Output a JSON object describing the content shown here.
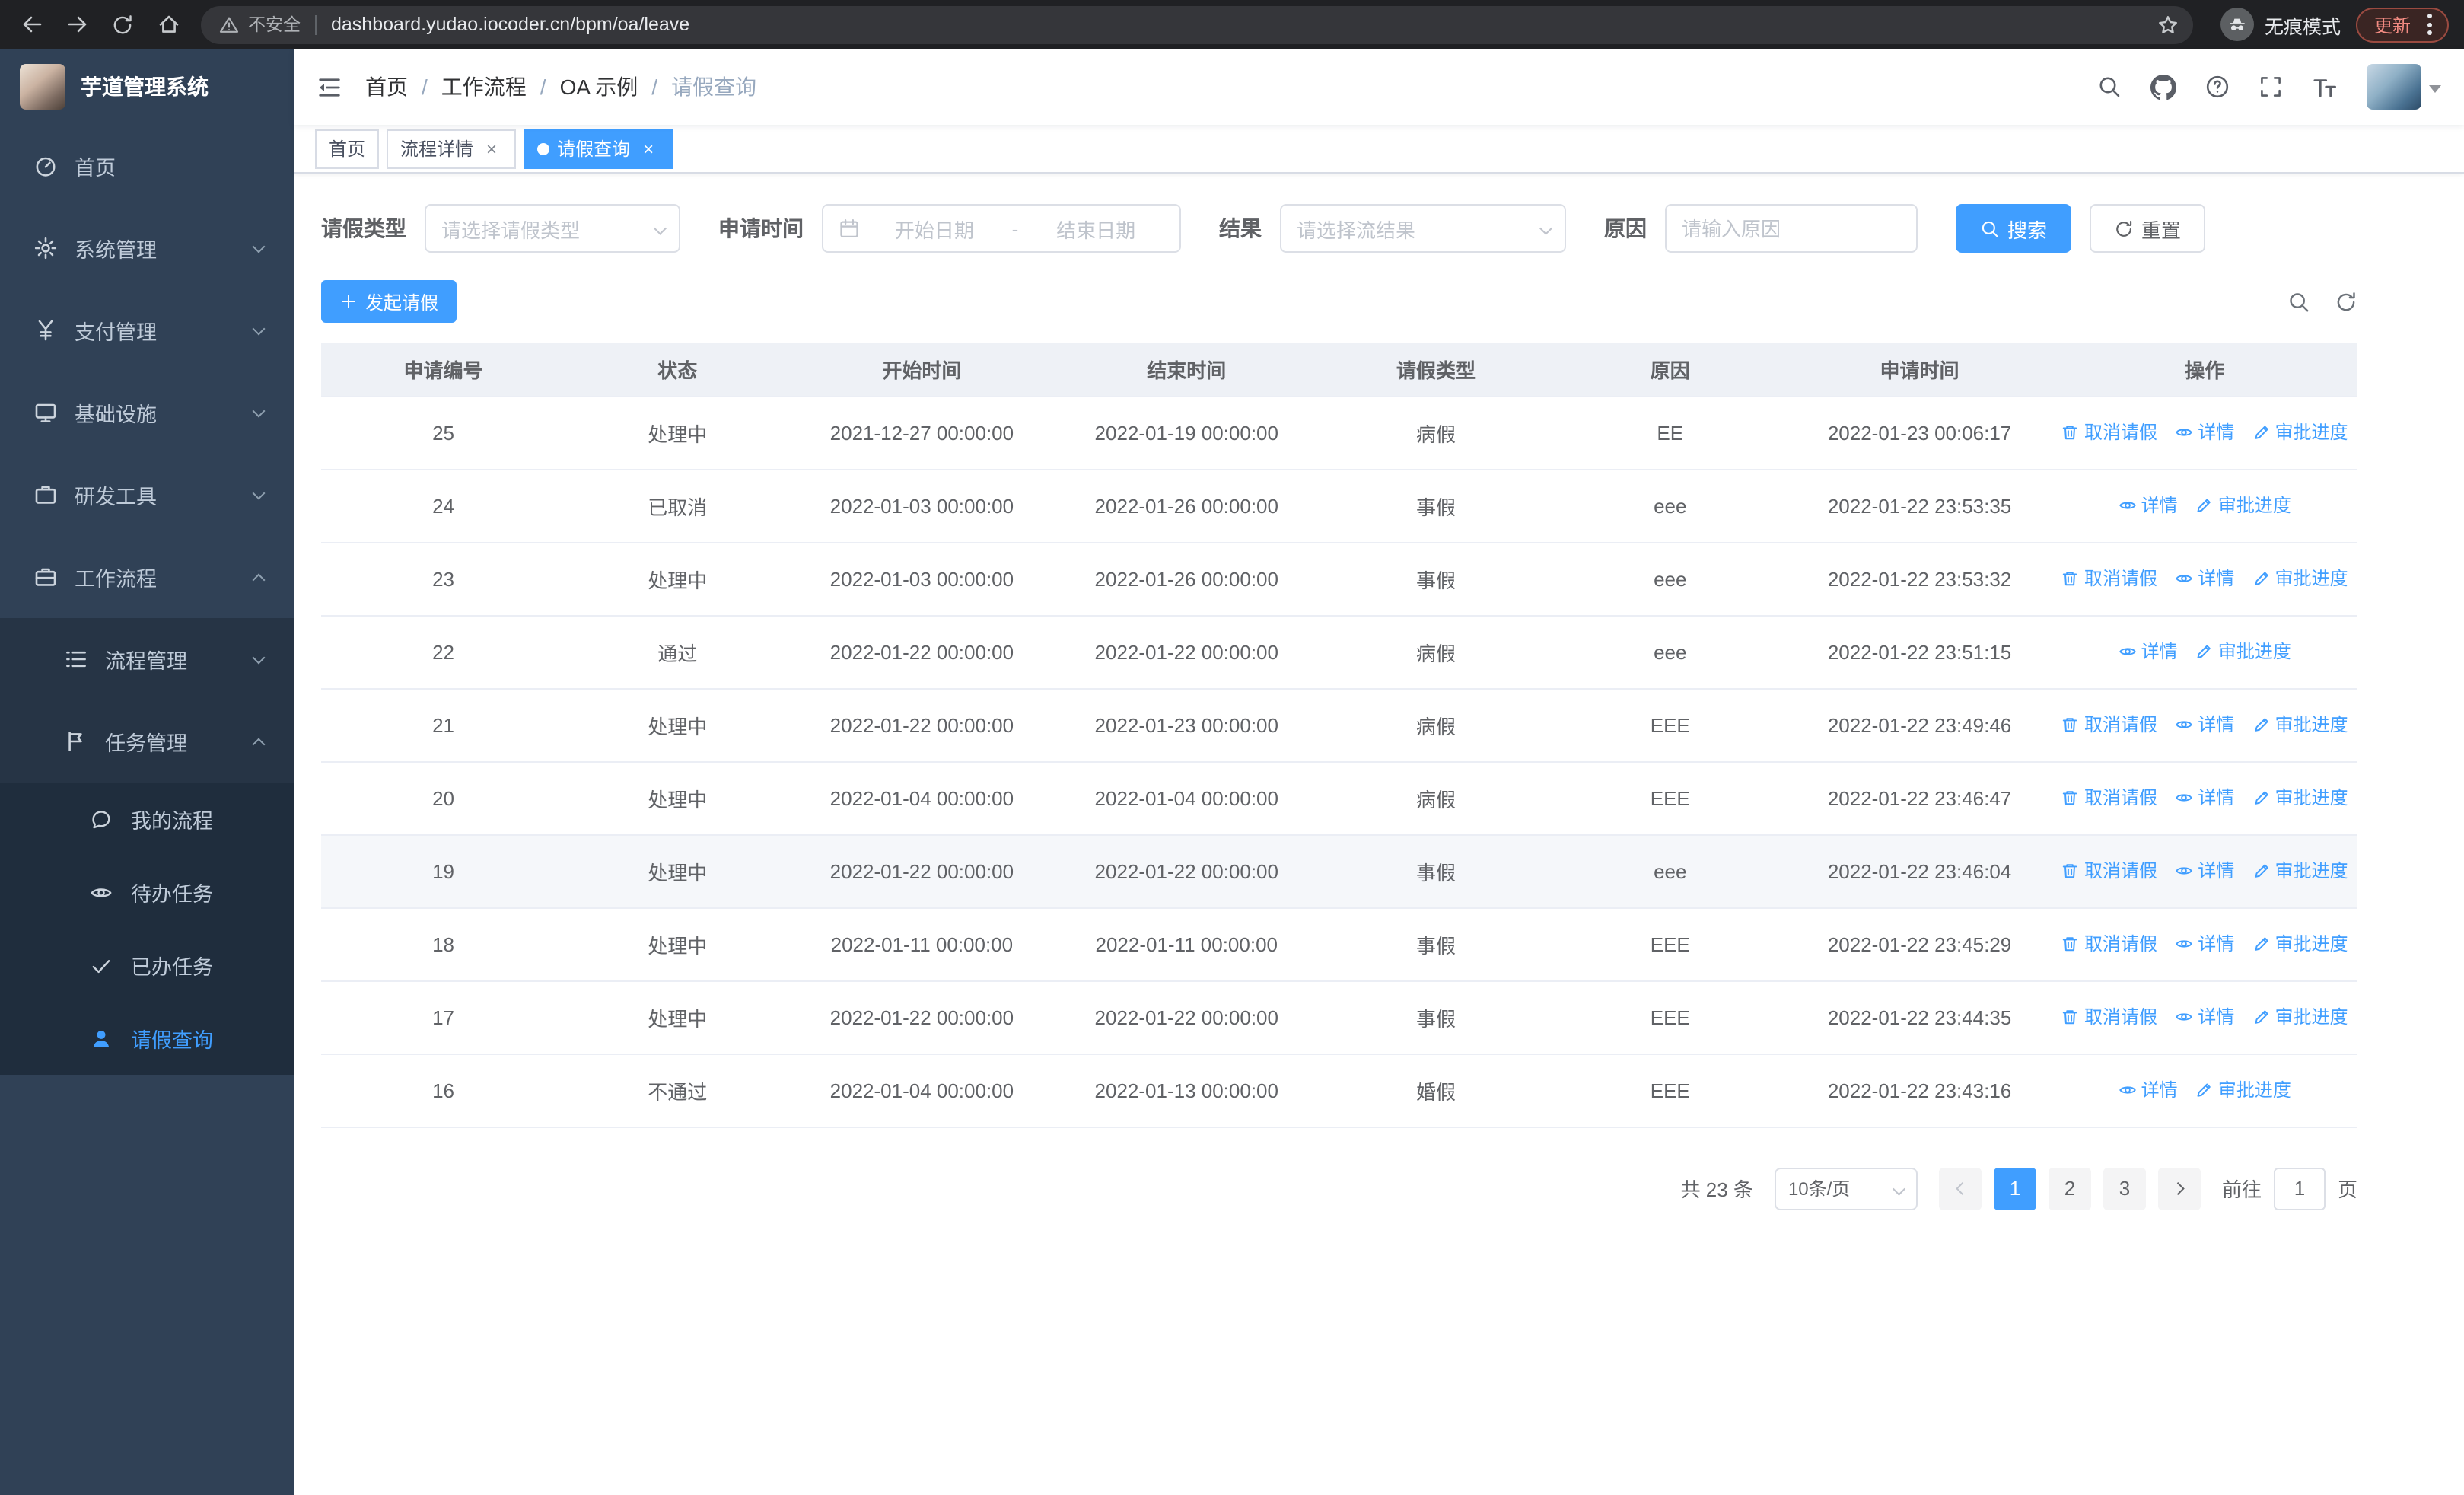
{
  "browser": {
    "security_label": "不安全",
    "url": "dashboard.yudao.iocoder.cn/bpm/oa/leave",
    "incognito_label": "无痕模式",
    "update_label": "更新"
  },
  "icons": {
    "close_glyph": "×"
  },
  "sidebar": {
    "logo_title": "芋道管理系统",
    "items": [
      {
        "label": "首页"
      },
      {
        "label": "系统管理"
      },
      {
        "label": "支付管理"
      },
      {
        "label": "基础设施"
      },
      {
        "label": "研发工具"
      },
      {
        "label": "工作流程"
      },
      {
        "label": "流程管理"
      },
      {
        "label": "任务管理"
      },
      {
        "label": "我的流程"
      },
      {
        "label": "待办任务"
      },
      {
        "label": "已办任务"
      },
      {
        "label": "请假查询"
      }
    ]
  },
  "breadcrumb": {
    "separator": "/",
    "items": [
      "首页",
      "工作流程",
      "OA 示例",
      "请假查询"
    ]
  },
  "tabs": [
    {
      "label": "首页"
    },
    {
      "label": "流程详情"
    },
    {
      "label": "请假查询"
    }
  ],
  "filters": {
    "leave_type_label": "请假类型",
    "leave_type_placeholder": "请选择请假类型",
    "apply_time_label": "申请时间",
    "start_placeholder": "开始日期",
    "range_separator": "-",
    "end_placeholder": "结束日期",
    "result_label": "结果",
    "result_placeholder": "请选择流结果",
    "reason_label": "原因",
    "reason_placeholder": "请输入原因",
    "search_label": "搜索",
    "reset_label": "重置"
  },
  "toolbar": {
    "create_label": "发起请假"
  },
  "table": {
    "columns": [
      "申请编号",
      "状态",
      "开始时间",
      "结束时间",
      "请假类型",
      "原因",
      "申请时间",
      "操作"
    ],
    "actions": {
      "cancel_label": "取消请假",
      "detail_label": "详情",
      "progress_label": "审批进度"
    },
    "rows": [
      {
        "id": "25",
        "status": "处理中",
        "start_time": "2021-12-27 00:00:00",
        "end_time": "2022-01-19 00:00:00",
        "leave_type": "病假",
        "reason": "EE",
        "apply_time": "2022-01-23 00:06:17",
        "can_cancel": true
      },
      {
        "id": "24",
        "status": "已取消",
        "start_time": "2022-01-03 00:00:00",
        "end_time": "2022-01-26 00:00:00",
        "leave_type": "事假",
        "reason": "eee",
        "apply_time": "2022-01-22 23:53:35",
        "can_cancel": false
      },
      {
        "id": "23",
        "status": "处理中",
        "start_time": "2022-01-03 00:00:00",
        "end_time": "2022-01-26 00:00:00",
        "leave_type": "事假",
        "reason": "eee",
        "apply_time": "2022-01-22 23:53:32",
        "can_cancel": true
      },
      {
        "id": "22",
        "status": "通过",
        "start_time": "2022-01-22 00:00:00",
        "end_time": "2022-01-22 00:00:00",
        "leave_type": "病假",
        "reason": "eee",
        "apply_time": "2022-01-22 23:51:15",
        "can_cancel": false
      },
      {
        "id": "21",
        "status": "处理中",
        "start_time": "2022-01-22 00:00:00",
        "end_time": "2022-01-23 00:00:00",
        "leave_type": "病假",
        "reason": "EEE",
        "apply_time": "2022-01-22 23:49:46",
        "can_cancel": true
      },
      {
        "id": "20",
        "status": "处理中",
        "start_time": "2022-01-04 00:00:00",
        "end_time": "2022-01-04 00:00:00",
        "leave_type": "病假",
        "reason": "EEE",
        "apply_time": "2022-01-22 23:46:47",
        "can_cancel": true
      },
      {
        "id": "19",
        "status": "处理中",
        "start_time": "2022-01-22 00:00:00",
        "end_time": "2022-01-22 00:00:00",
        "leave_type": "事假",
        "reason": "eee",
        "apply_time": "2022-01-22 23:46:04",
        "can_cancel": true,
        "highlighted": true
      },
      {
        "id": "18",
        "status": "处理中",
        "start_time": "2022-01-11 00:00:00",
        "end_time": "2022-01-11 00:00:00",
        "leave_type": "事假",
        "reason": "EEE",
        "apply_time": "2022-01-22 23:45:29",
        "can_cancel": true
      },
      {
        "id": "17",
        "status": "处理中",
        "start_time": "2022-01-22 00:00:00",
        "end_time": "2022-01-22 00:00:00",
        "leave_type": "事假",
        "reason": "EEE",
        "apply_time": "2022-01-22 23:44:35",
        "can_cancel": true
      },
      {
        "id": "16",
        "status": "不通过",
        "start_time": "2022-01-04 00:00:00",
        "end_time": "2022-01-13 00:00:00",
        "leave_type": "婚假",
        "reason": "EEE",
        "apply_time": "2022-01-22 23:43:16",
        "can_cancel": false
      }
    ]
  },
  "pagination": {
    "total_label": "共 23 条",
    "page_size_label": "10条/页",
    "pages": [
      "1",
      "2",
      "3"
    ],
    "active_page": "1",
    "goto_label": "前往",
    "goto_value": "1",
    "goto_suffix_label": "页"
  },
  "colors": {
    "accent": "#409eff",
    "sidebar_bg": "#304156",
    "submenu_bg": "#1f2d3d"
  }
}
